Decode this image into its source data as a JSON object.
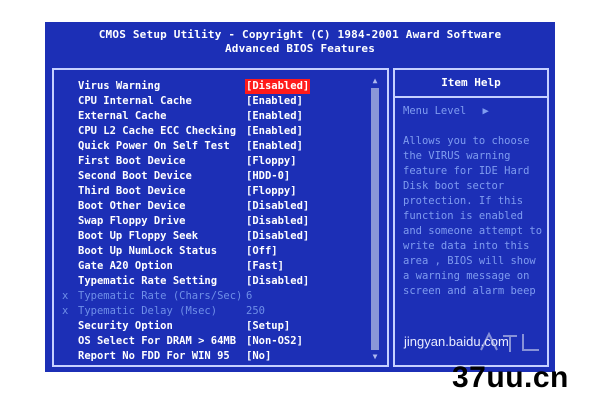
{
  "header": {
    "line1": "CMOS Setup Utility - Copyright (C) 1984-2001 Award Software",
    "line2": "Advanced BIOS Features"
  },
  "settings": [
    {
      "label": "Virus Warning",
      "value": "[Disabled]",
      "selected": true
    },
    {
      "label": "CPU Internal Cache",
      "value": "[Enabled]"
    },
    {
      "label": "External Cache",
      "value": "[Enabled]"
    },
    {
      "label": "CPU L2 Cache ECC Checking",
      "value": "[Enabled]"
    },
    {
      "label": "Quick Power On Self Test",
      "value": "[Enabled]"
    },
    {
      "label": "First Boot Device",
      "value": "[Floppy]"
    },
    {
      "label": "Second Boot Device",
      "value": "[HDD-0]"
    },
    {
      "label": "Third Boot Device",
      "value": "[Floppy]"
    },
    {
      "label": "Boot Other Device",
      "value": "[Disabled]"
    },
    {
      "label": "Swap Floppy Drive",
      "value": "[Disabled]"
    },
    {
      "label": "Boot Up Floppy Seek",
      "value": "[Disabled]"
    },
    {
      "label": "Boot Up NumLock Status",
      "value": "[Off]"
    },
    {
      "label": "Gate A20 Option",
      "value": "[Fast]"
    },
    {
      "label": "Typematic Rate Setting",
      "value": "[Disabled]"
    },
    {
      "label": "Typematic Rate (Chars/Sec)",
      "value": "6",
      "disabled": true,
      "marker": "x"
    },
    {
      "label": "Typematic Delay (Msec)",
      "value": "250",
      "disabled": true,
      "marker": "x"
    },
    {
      "label": "Security Option",
      "value": "[Setup]"
    },
    {
      "label": "OS Select For DRAM > 64MB",
      "value": "[Non-OS2]"
    },
    {
      "label": "Report No FDD For WIN 95",
      "value": "[No]"
    }
  ],
  "help": {
    "title": "Item Help",
    "menu_level": "Menu Level",
    "menu_level_arrow": "▶",
    "lines": [
      "Allows you to choose",
      "the VIRUS warning",
      "feature for IDE Hard",
      "Disk boot sector",
      "protection. If this",
      "function is enabled",
      "and someone attempt to",
      "write data into this",
      "area , BIOS will show",
      "a warning message on",
      "screen and alarm beep"
    ]
  },
  "scrollbar": {
    "up_arrow": "▲",
    "down_arrow": "▼"
  },
  "watermarks": {
    "site": "jingyan.baidu.com",
    "brand": "37uu.cn"
  },
  "colors": {
    "bios_blue": "#1c2fb6",
    "highlight_red": "#ff1a1a",
    "border": "#c6d0ff",
    "help_text": "#7f9cf0"
  }
}
